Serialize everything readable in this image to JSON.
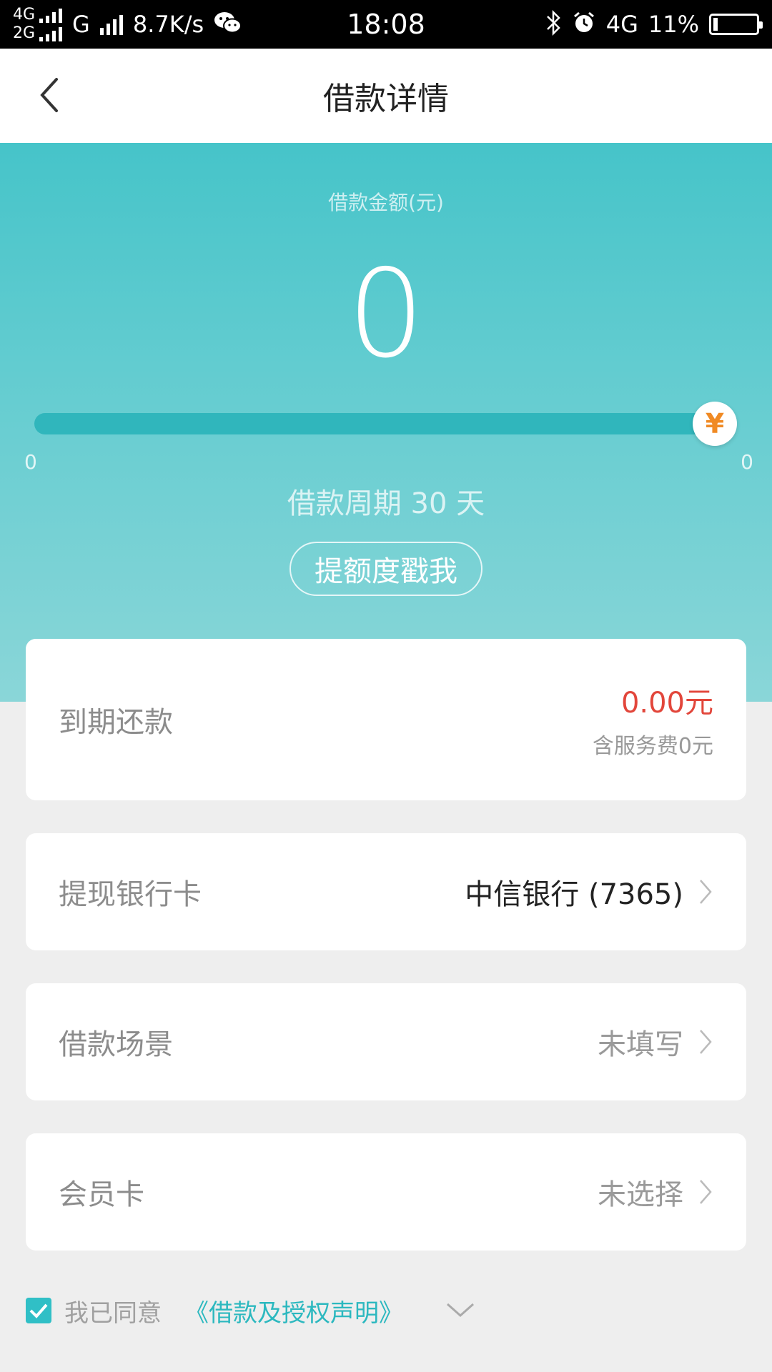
{
  "status_bar": {
    "net1": "4G",
    "net2": "2G",
    "net3": "G",
    "speed": "8.7K/s",
    "time": "18:08",
    "net4": "4G",
    "battery": "11%"
  },
  "nav": {
    "title": "借款详情"
  },
  "hero": {
    "amount_label": "借款金额(元)",
    "amount_value": "0",
    "slider_min": "0",
    "slider_max": "0",
    "slider_handle_symbol": "¥",
    "period_text": "借款周期 30 天",
    "raise_button": "提额度戳我"
  },
  "due": {
    "label": "到期还款",
    "amount": "0.00元",
    "fee": "含服务费0元"
  },
  "bank": {
    "label": "提现银行卡",
    "value": "中信银行 (7365)"
  },
  "scene": {
    "label": "借款场景",
    "value": "未填写"
  },
  "member": {
    "label": "会员卡",
    "value": "未选择"
  },
  "agreement": {
    "text": "我已同意",
    "link": "《借款及授权声明》",
    "checked": true
  },
  "colors": {
    "accent": "#30bfc6",
    "due_amount": "#e2463b",
    "handle_symbol": "#f08a24"
  }
}
